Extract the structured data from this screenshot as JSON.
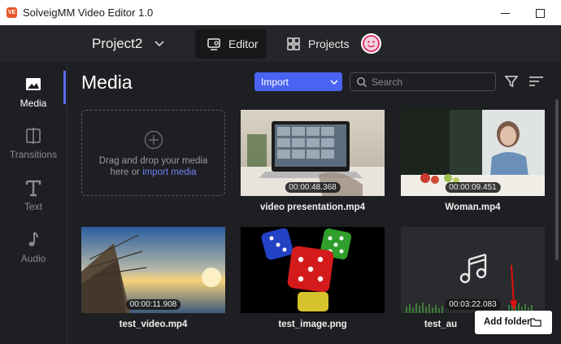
{
  "window": {
    "title": "SolveigMM Video Editor 1.0",
    "app_icon_text": "VE"
  },
  "topbar": {
    "project_name": "Project2",
    "tabs": [
      {
        "label": "Editor",
        "icon": "editor-icon",
        "active": true
      },
      {
        "label": "Projects",
        "icon": "projects-grid-icon",
        "active": false
      }
    ],
    "avatar_icon": "smiley-avatar-icon"
  },
  "sidebar": {
    "items": [
      {
        "label": "Media",
        "icon": "image-icon",
        "active": true
      },
      {
        "label": "Transitions",
        "icon": "transitions-icon",
        "active": false
      },
      {
        "label": "Text",
        "icon": "text-icon",
        "active": false
      },
      {
        "label": "Audio",
        "icon": "music-note-icon",
        "active": false
      }
    ]
  },
  "main": {
    "title": "Media",
    "import_label": "Import",
    "search_placeholder": "Search",
    "drop_zone": {
      "line1": "Drag and drop your media",
      "line2_prefix": "here or ",
      "line2_link": "import media"
    },
    "items": [
      {
        "name": "video presentation.mp4",
        "duration": "00:00:48.368"
      },
      {
        "name": "Woman.mp4",
        "duration": "00:00:09.451"
      },
      {
        "name": "test_video.mp4",
        "duration": "00:00:11.908"
      },
      {
        "name": "test_image.png",
        "duration": ""
      },
      {
        "name": "test_au",
        "duration": "00:03:22.083"
      }
    ],
    "add_folder_label": "Add folder"
  },
  "colors": {
    "accent": "#4a63f2",
    "background": "#1e1f22",
    "annotation_arrow": "#e01010"
  }
}
